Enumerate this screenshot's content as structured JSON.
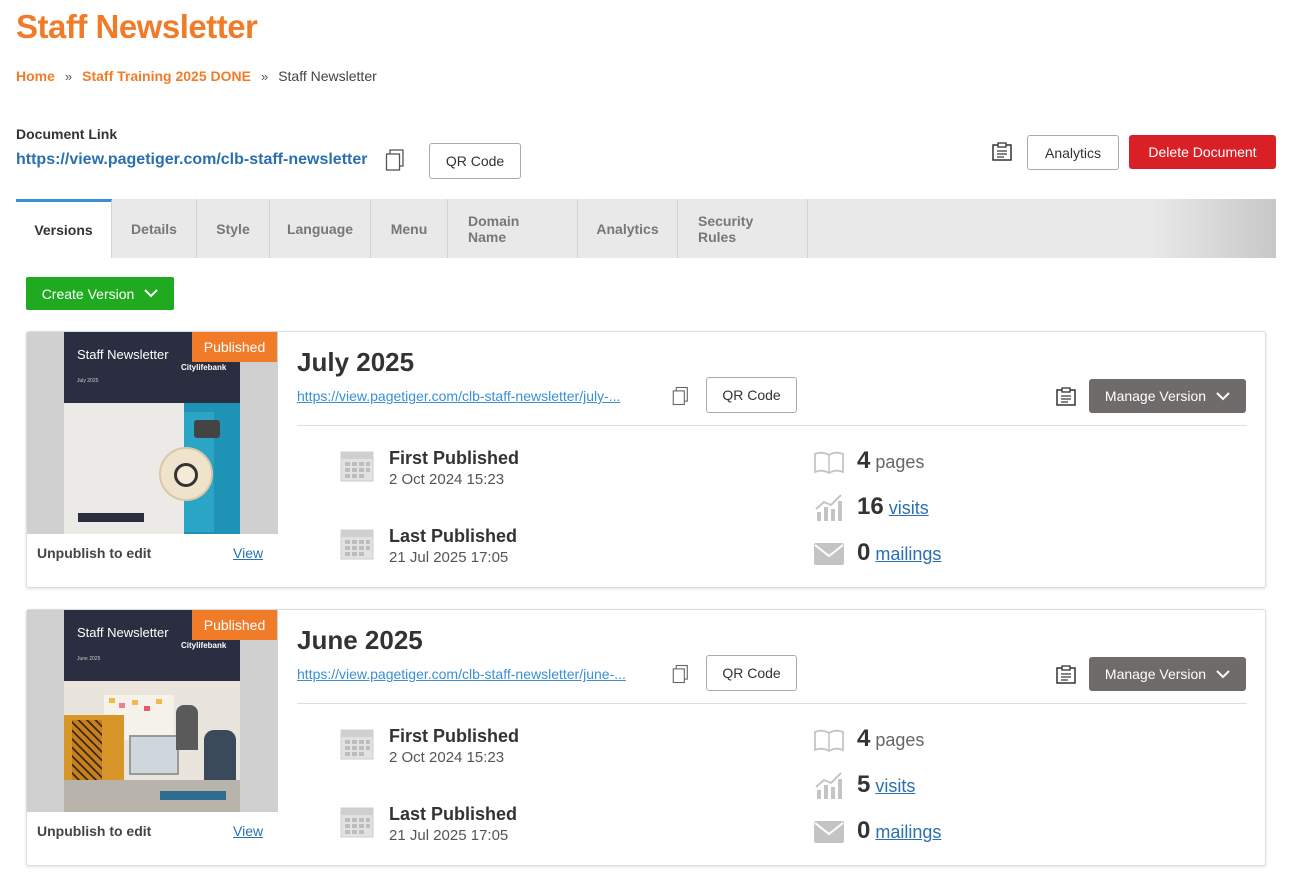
{
  "page": {
    "title": "Staff Newsletter"
  },
  "breadcrumb": {
    "home": "Home",
    "sep": "»",
    "parent": "Staff Training 2025 DONE",
    "current": "Staff Newsletter"
  },
  "document": {
    "link_label": "Document Link",
    "link_url": "https://view.pagetiger.com/clb-staff-newsletter",
    "qr_label": "QR Code",
    "analytics_label": "Analytics",
    "delete_label": "Delete Document"
  },
  "tabs": [
    "Versions",
    "Details",
    "Style",
    "Language",
    "Menu",
    "Domain Name",
    "Analytics",
    "Security Rules"
  ],
  "create_version_label": "Create Version",
  "versions": [
    {
      "badge": "Published",
      "cover_title": "Staff Newsletter",
      "cover_date": "July 2025",
      "cover_brand": "Citylifebank",
      "title": "July 2025",
      "url": "https://view.pagetiger.com/clb-staff-newsletter/july-...",
      "qr_label": "QR Code",
      "manage_label": "Manage Version",
      "unpublish_label": "Unpublish to edit",
      "view_label": "View",
      "first_published_label": "First Published",
      "first_published_date": "2 Oct 2024 15:23",
      "last_published_label": "Last Published",
      "last_published_date": "21 Jul 2025 17:05",
      "pages_count": "4",
      "pages_label": "pages",
      "visits_count": "16",
      "visits_label": "visits",
      "mailings_count": "0",
      "mailings_label": "mailings"
    },
    {
      "badge": "Published",
      "cover_title": "Staff Newsletter",
      "cover_date": "June 2025",
      "cover_brand": "Citylifebank",
      "title": "June 2025",
      "url": "https://view.pagetiger.com/clb-staff-newsletter/june-...",
      "qr_label": "QR Code",
      "manage_label": "Manage Version",
      "unpublish_label": "Unpublish to edit",
      "view_label": "View",
      "first_published_label": "First Published",
      "first_published_date": "2 Oct 2024 15:23",
      "last_published_label": "Last Published",
      "last_published_date": "21 Jul 2025 17:05",
      "pages_count": "4",
      "pages_label": "pages",
      "visits_count": "5",
      "visits_label": "visits",
      "mailings_count": "0",
      "mailings_label": "mailings"
    }
  ],
  "colors": {
    "brand": "#f07c2a",
    "link": "#2a6fb0",
    "danger": "#d92027",
    "success": "#1faa1f",
    "manage": "#6f6b6a"
  }
}
